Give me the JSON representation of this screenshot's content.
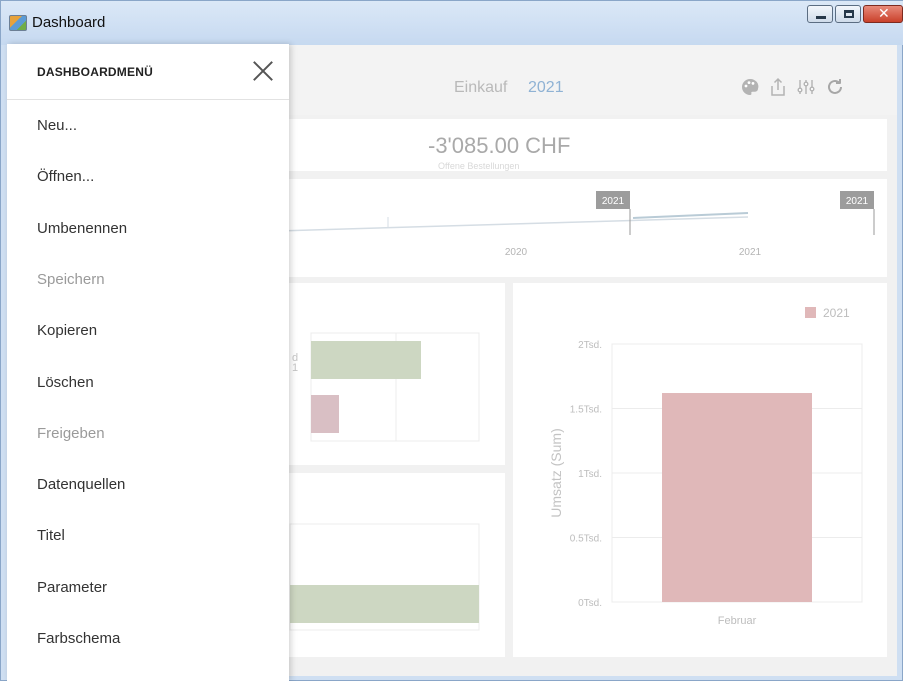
{
  "window": {
    "title": "Dashboard"
  },
  "header": {
    "title": "Einkauf",
    "year": "2021",
    "icons": [
      "palette-icon",
      "export-icon",
      "filter-settings-icon",
      "refresh-icon"
    ]
  },
  "kpi": {
    "value": "-3'085.00 CHF",
    "sub": "Offene Bestellungen"
  },
  "timeline": {
    "badge_left": "2021",
    "badge_right": "2021",
    "labels": [
      "2020",
      "2021"
    ]
  },
  "small_chart": {
    "legend_fragment_1": "d",
    "legend_fragment_2": "1"
  },
  "chart_data": {
    "type": "bar",
    "categories": [
      "Februar"
    ],
    "series": [
      {
        "name": "2021",
        "values": [
          1620
        ]
      }
    ],
    "ylabel": "Umsatz (Sum)",
    "ylim": [
      0,
      2000
    ],
    "yticks": [
      "0Tsd.",
      "0.5Tsd.",
      "1Tsd.",
      "1.5Tsd.",
      "2Tsd."
    ],
    "legend_position": "top-right",
    "color": "#e0b8b9"
  },
  "menu": {
    "title": "DASHBOARDMENÜ",
    "items": [
      {
        "label": "Neu...",
        "enabled": true
      },
      {
        "label": "Öffnen...",
        "enabled": true
      },
      {
        "label": "Umbenennen",
        "enabled": true
      },
      {
        "label": "Speichern",
        "enabled": false
      },
      {
        "label": "Kopieren",
        "enabled": true
      },
      {
        "label": "Löschen",
        "enabled": true
      },
      {
        "label": "Freigeben",
        "enabled": false
      },
      {
        "label": "Datenquellen",
        "enabled": true
      },
      {
        "label": "Titel",
        "enabled": true
      },
      {
        "label": "Parameter",
        "enabled": true
      },
      {
        "label": "Farbschema",
        "enabled": true
      }
    ]
  }
}
